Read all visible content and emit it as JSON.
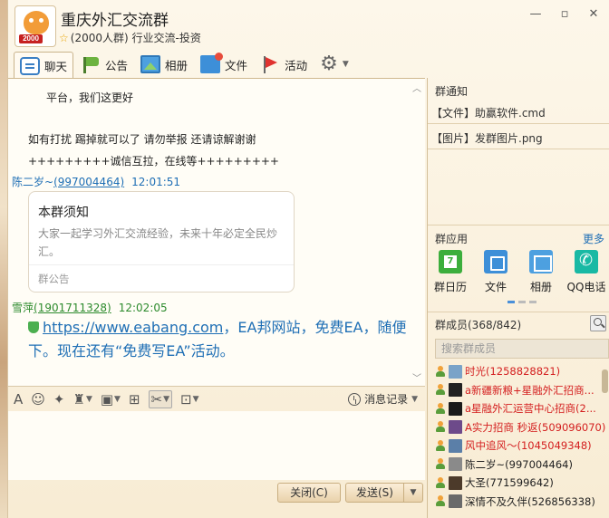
{
  "header": {
    "title": "重庆外汇交流群",
    "subtitle": "(2000人群) 行业交流-投资",
    "avatar_badge": "2000",
    "controls": [
      "minimize-icon",
      "restore-icon",
      "close-icon"
    ]
  },
  "toolbar": {
    "chat": "聊天",
    "notice": "公告",
    "album": "相册",
    "files": "文件",
    "activity": "活动"
  },
  "chat": {
    "line1": "平台，我们这更好",
    "line2": "如有打扰 踢掉就可以了 请勿举报 还请谅解谢谢",
    "line3": "+++++++++诚信互拉，在线等+++++++++",
    "msg1": {
      "name": "陈二岁~",
      "qq": "(997004464)",
      "time": "12:01:51"
    },
    "card": {
      "title": "本群须知",
      "body": "大家一起学习外汇交流经验，未来十年必定全民炒汇。",
      "footer": "群公告"
    },
    "msg2": {
      "name": "雪萍",
      "qq": "(1901711328)",
      "time": "12:02:05"
    },
    "ad_link": "https://www.eabang.com",
    "ad_text": "，EA邦网站，免费EA，随便下。现在还有“免费写EA”活动。"
  },
  "input": {
    "history": "消息记录",
    "close": "关闭(C)",
    "send": "发送(S)"
  },
  "right": {
    "notice_head": "群通知",
    "notices": [
      "【文件】助赢软件.cmd",
      "【图片】发群图片.png"
    ],
    "apps_head": "群应用",
    "more": "更多",
    "apps": [
      "群日历",
      "文件",
      "相册",
      "QQ电话"
    ],
    "members_head": "群成员(368/842)",
    "search_placeholder": "搜索群成员",
    "members": [
      {
        "name": "时光(1258828821)",
        "red": true
      },
      {
        "name": "a新疆新粮+星融外汇招商...",
        "red": true
      },
      {
        "name": "a星融外汇运营中心招商(2...",
        "red": true
      },
      {
        "name": "A实力招商 秒返(509096070)",
        "red": true
      },
      {
        "name": "风中追风～(1045049348)",
        "red": true
      },
      {
        "name": "陈二岁~(997004464)",
        "red": false
      },
      {
        "name": "大圣(771599642)",
        "red": false
      },
      {
        "name": "深情不及久伴(526856338)",
        "red": false
      }
    ]
  },
  "colors": {
    "accent_blue": "#1f6fb5",
    "member_red": "#d42020",
    "sender_green": "#2c8a2c"
  }
}
